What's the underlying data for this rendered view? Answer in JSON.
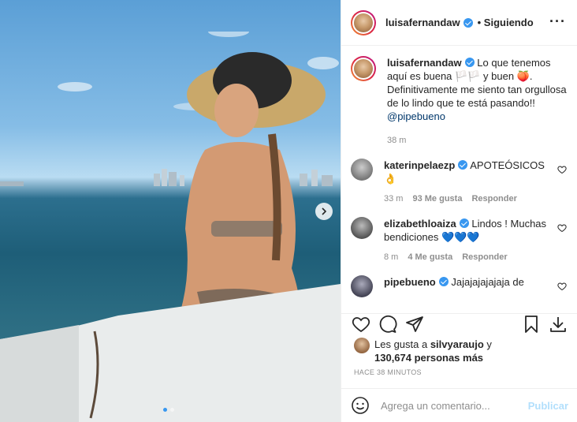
{
  "post": {
    "username": "luisafernandaw",
    "follow_state": "• Siguiendo",
    "more_icon": "more-horizontal-icon",
    "caption_prefix": "Lo que tenemos aquí es buena ",
    "caption_emoji_1": "🏳️🏳️",
    "caption_mid": " y buen ",
    "caption_emoji_2": "🍑",
    "caption_suffix": ". Definitivamente me siento tan orgullosa de lo lindo que te está pasando!! ",
    "caption_mention": "@pipebueno",
    "caption_time": "38 m",
    "likes_prefix": "Les gusta a ",
    "likes_user": "silvyaraujo",
    "likes_mid": " y ",
    "likes_count": "130,674 personas más",
    "time_ago": "HACE 38 MINUTOS",
    "slide_index": 1,
    "slide_count": 2
  },
  "comments": [
    {
      "username": "katerinpelaezp",
      "verified": true,
      "text": "APOTEÓSICOS 👌",
      "time": "33 m",
      "likes": "93 Me gusta",
      "reply": "Responder"
    },
    {
      "username": "elizabethloaiza",
      "verified": true,
      "text": "Lindos ! Muchas bendiciones 💙💙💙",
      "time": "8 m",
      "likes": "4 Me gusta",
      "reply": "Responder"
    },
    {
      "username": "pipebueno",
      "verified": true,
      "text": "Jajajajajajaja de",
      "time": "",
      "likes": "",
      "reply": ""
    }
  ],
  "add_comment": {
    "placeholder": "Agrega un comentario...",
    "publish": "Publicar"
  },
  "colors": {
    "accent": "#3897f0",
    "publish_disabled": "#b2dffc",
    "muted": "#8e8e8e"
  }
}
